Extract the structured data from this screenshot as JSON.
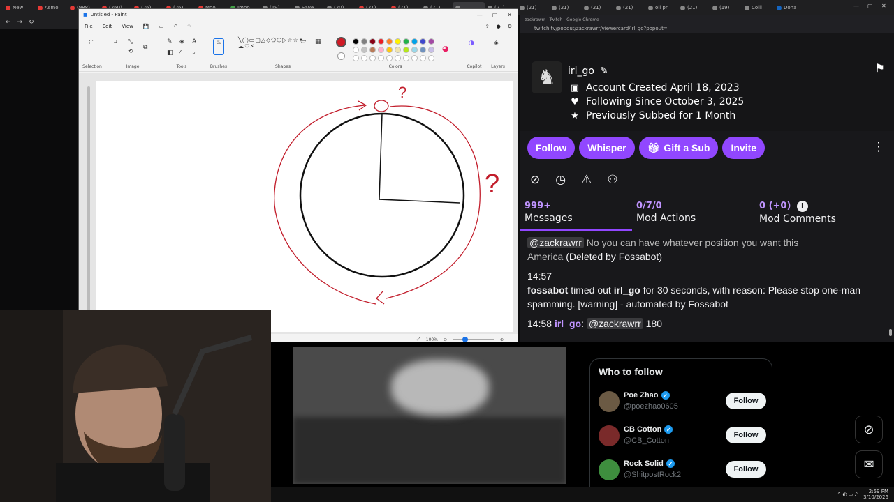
{
  "tabs": [
    {
      "label": "New",
      "color": "#e53935"
    },
    {
      "label": "Asmo",
      "color": "#e53935"
    },
    {
      "label": "(988)",
      "color": "#e53935"
    },
    {
      "label": "(260)",
      "color": "#e53935"
    },
    {
      "label": "(26)",
      "color": "#e53935"
    },
    {
      "label": "(26)",
      "color": "#e53935"
    },
    {
      "label": "Moo",
      "color": "#e53935"
    },
    {
      "label": "Impo",
      "color": "#43a047"
    },
    {
      "label": "(19)",
      "color": "#888"
    },
    {
      "label": "Save",
      "color": "#888"
    },
    {
      "label": "(20)",
      "color": "#888"
    },
    {
      "label": "(21)",
      "color": "#e53935"
    },
    {
      "label": "(21)",
      "color": "#e53935"
    },
    {
      "label": "(21)",
      "color": "#888"
    },
    {
      "label": "",
      "color": "#888",
      "active": true
    },
    {
      "label": "(21)",
      "color": "#888"
    },
    {
      "label": "(21)",
      "color": "#888"
    },
    {
      "label": "(21)",
      "color": "#888"
    },
    {
      "label": "(21)",
      "color": "#888"
    },
    {
      "label": "(21)",
      "color": "#888"
    },
    {
      "label": "oil pr",
      "color": "#888"
    },
    {
      "label": "(21)",
      "color": "#888"
    },
    {
      "label": "(19)",
      "color": "#888"
    },
    {
      "label": "Colli",
      "color": "#888"
    },
    {
      "label": "Dona",
      "color": "#1565c0"
    }
  ],
  "paint": {
    "title": "Untitled - Paint",
    "menu": {
      "file": "File",
      "edit": "Edit",
      "view": "View"
    },
    "groups": {
      "selection": "Selection",
      "image": "Image",
      "tools": "Tools",
      "brushes": "Brushes",
      "shapes": "Shapes",
      "colors": "Colors",
      "copilot": "Copilot",
      "layers": "Layers"
    },
    "palette": [
      "#000000",
      "#7f7f7f",
      "#880015",
      "#ed1c24",
      "#ff7f27",
      "#fff200",
      "#22b14c",
      "#00a2e8",
      "#3f48cc",
      "#a349a4",
      "#ffffff",
      "#c3c3c3",
      "#b97a57",
      "#ffaec9",
      "#ffc90e",
      "#efe4b0",
      "#b5e61d",
      "#99d9ea",
      "#7092be",
      "#c8bfe7",
      "#ffffff",
      "#ffffff",
      "#ffffff",
      "#ffffff",
      "#ffffff",
      "#ffffff",
      "#ffffff",
      "#ffffff",
      "#ffffff",
      "#ffffff"
    ],
    "zoom": "100%",
    "drawing": {
      "question_mark_top": "?",
      "question_mark_right": "?"
    }
  },
  "twitch": {
    "window_title": "zackrawrr - Twitch - Google Chrome",
    "url": "twitch.tv/popout/zackrawrr/viewercard/irl_go?popout=",
    "username": "irl_go",
    "account_created": "Account Created April 18, 2023",
    "following_since": "Following Since October 3, 2025",
    "previously_subbed": "Previously Subbed for 1 Month",
    "buttons": {
      "follow": "Follow",
      "whisper": "Whisper",
      "gift_sub": "Gift a Sub",
      "invite": "Invite"
    },
    "stats": {
      "messages_count": "999+",
      "messages_label": "Messages",
      "mod_actions_count": "0/7/0",
      "mod_actions_label": "Mod Actions",
      "mod_comments_count": "0 (+0)",
      "mod_comments_label": "Mod Comments"
    },
    "chat": {
      "deleted_mention": "@zackrawrr",
      "deleted_text": " No you can have whatever position you want this",
      "deleted_text2": "America",
      "deleted_note": " (Deleted by Fossabot)",
      "time1": "14:57",
      "bot_name": "fossabot",
      "timeout_text1": " timed out ",
      "timeout_user": "irl_go",
      "timeout_text2": " for 30 seconds, with reason: Please stop one-man spamming. [warning] - automated by Fossabot",
      "time2": "14:58",
      "msg_user": "irl_go",
      "msg_colon": ": ",
      "msg_mention": "@zackrawrr",
      "msg_text": " 180"
    }
  },
  "who_to_follow": {
    "title": "Who to follow",
    "follow_label": "Follow",
    "accounts": [
      {
        "name": "Poe Zhao",
        "handle": "@poezhao0605",
        "color": "#6b5a44"
      },
      {
        "name": "CB Cotton",
        "handle": "@CB_Cotton",
        "color": "#7a2a2a"
      },
      {
        "name": "Rock Solid",
        "handle": "@ShitpostRock2",
        "color": "#3e8e3e"
      }
    ]
  },
  "taskbar": {
    "time": "2:59 PM",
    "date": "3/10/2026"
  }
}
